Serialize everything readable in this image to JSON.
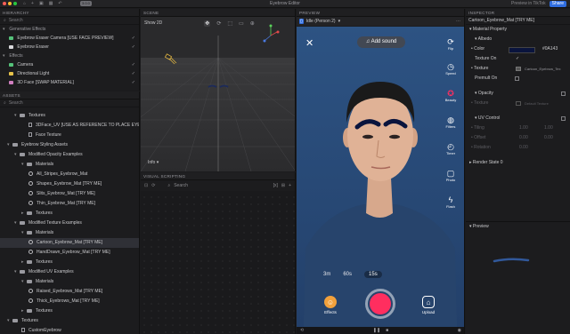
{
  "titlebar": {
    "title": "Eyebrow Editor",
    "badge": "3.0.0",
    "preview_link": "Preview in TikTok",
    "share_label": "Share",
    "colors": {
      "close": "#ff5f57",
      "min": "#febc2e",
      "max": "#28c840",
      "accent": "#2f6de0"
    }
  },
  "hierarchy": {
    "header": "HIERARCHY",
    "search_placeholder": "Search",
    "groups": [
      {
        "label": "Generative Effects",
        "items": [
          "Eyebrow Eraser Camera [USE FACE PREVIEW]",
          "Eyebrow Eraser"
        ]
      },
      {
        "label": "Effects",
        "items": [
          "Camera",
          "Directional Light",
          "3D Face [SWAP MATERIAL]"
        ]
      }
    ]
  },
  "assets": {
    "header": "ASSETS",
    "search_placeholder": "Search",
    "rows": [
      {
        "label": "Textures",
        "kind": "folder",
        "level": 1,
        "open": true
      },
      {
        "label": "3DFace_UV [USE AS REFERENCE TO PLACE EYEBROWS]",
        "kind": "file",
        "level": 3
      },
      {
        "label": "Face Texture",
        "kind": "file",
        "level": 3
      },
      {
        "label": "Eyebrow Styling Assets",
        "kind": "folder",
        "level": 0,
        "open": true
      },
      {
        "label": "Modified Opacity Examples",
        "kind": "folder",
        "level": 1,
        "open": true
      },
      {
        "label": "Materials",
        "kind": "folder",
        "level": 2,
        "open": true
      },
      {
        "label": "All_Stripes_Eyebrow_Mat",
        "kind": "mat",
        "level": 3
      },
      {
        "label": "Shapes_Eyebrow_Mat [TRY ME]",
        "kind": "mat",
        "level": 3
      },
      {
        "label": "Slits_Eyebrow_Mat [TRY ME]",
        "kind": "mat",
        "level": 3
      },
      {
        "label": "Thin_Eyebrow_Mat [TRY ME]",
        "kind": "mat",
        "level": 3
      },
      {
        "label": "Textures",
        "kind": "folder",
        "level": 2,
        "open": false
      },
      {
        "label": "Modified Texture Examples",
        "kind": "folder",
        "level": 1,
        "open": true
      },
      {
        "label": "Materials",
        "kind": "folder",
        "level": 2,
        "open": true
      },
      {
        "label": "Cartoon_Eyebrow_Mat [TRY ME]",
        "kind": "mat",
        "level": 3,
        "selected": true
      },
      {
        "label": "HandDrawn_Eyebrow_Mat [TRY ME]",
        "kind": "mat",
        "level": 3
      },
      {
        "label": "Textures",
        "kind": "folder",
        "level": 2,
        "open": false
      },
      {
        "label": "Modified UV Examples",
        "kind": "folder",
        "level": 1,
        "open": true
      },
      {
        "label": "Materials",
        "kind": "folder",
        "level": 2,
        "open": true
      },
      {
        "label": "Raised_Eyebrows_Mat [TRY ME]",
        "kind": "mat",
        "level": 3
      },
      {
        "label": "Thick_Eyebrows_Mat [TRY ME]",
        "kind": "mat",
        "level": 3
      },
      {
        "label": "Textures",
        "kind": "folder",
        "level": 2,
        "open": false
      },
      {
        "label": "Textures",
        "kind": "folder",
        "level": 0,
        "open": true
      },
      {
        "label": "CustomEyebrow",
        "kind": "file",
        "level": 2
      }
    ]
  },
  "scene": {
    "header": "SCENE",
    "show2d": "Show 2D",
    "info_dropdown": "Info"
  },
  "visual_scripting": {
    "header": "VISUAL SCRIPTING",
    "search_placeholder": "Search"
  },
  "preview": {
    "header": "PREVIEW",
    "mode": "Idle (Person 2)",
    "add_sound": "Add sound",
    "side_buttons": [
      "Flip",
      "Speed",
      "Beauty",
      "Filters",
      "Timer",
      "Photo",
      "Flash"
    ],
    "durations": [
      "3m",
      "60s",
      "15s"
    ],
    "active_duration": "15s",
    "effects_label": "Effects",
    "upload_label": "Upload",
    "record_color": "#ff2e5f"
  },
  "inspector": {
    "header": "INSPECTOR",
    "object_name": "Cartoon_Eyebrow_Mat [TRY ME]",
    "section_material": "Material Property",
    "section_albedo": "Albedo",
    "color_label": "Color",
    "color_hex": "#0A143D",
    "color_value": "#0A143",
    "texture_on_label": "Texture On",
    "texture_label": "Texture",
    "texture_value": "Cartoon_Eyebrow_Tex",
    "premult_label": "Premult On",
    "section_opacity": "Opacity",
    "opacity_texture_label": "Texture",
    "opacity_texture_value": "Default Texture",
    "section_uv": "UV Control",
    "tiling_label": "Tiling",
    "tiling_x": "1.00",
    "tiling_y": "1.00",
    "offset_label": "Offset",
    "offset_x": "0.00",
    "offset_y": "0.00",
    "rotation_label": "Rotation",
    "rotation_value": "0.00",
    "render_state": "Render State 0",
    "preview_header": "Preview"
  }
}
